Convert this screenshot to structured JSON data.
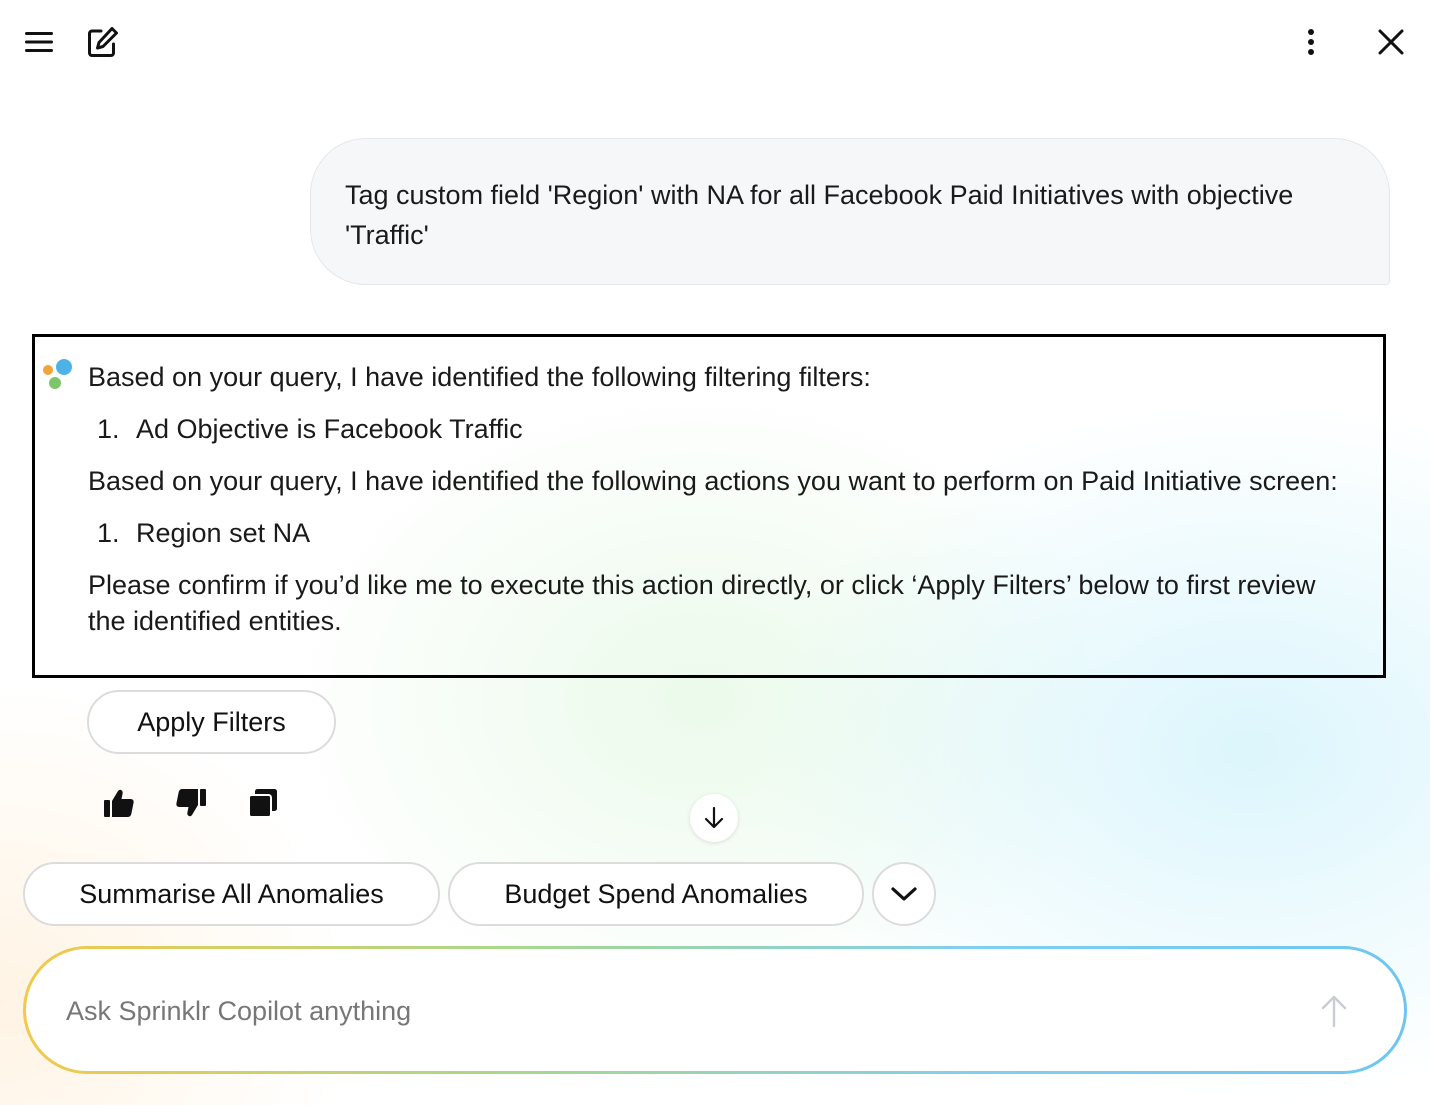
{
  "header": {
    "menu_icon": "hamburger-menu-icon",
    "new_chat_icon": "edit-compose-icon",
    "more_icon": "kebab-more-icon",
    "close_icon": "close-icon"
  },
  "conversation": {
    "user_message": "Tag custom field 'Region' with NA for all Facebook Paid Initiatives with objective 'Traffic'",
    "response": {
      "intro_filters": "Based on your query, I have identified the following filtering filters:",
      "filters": [
        {
          "num": "1.",
          "text": "Ad Objective is Facebook Traffic"
        }
      ],
      "intro_actions": "Based on your query, I have identified the following actions you want to perform on Paid Initiative screen:",
      "actions": [
        {
          "num": "1.",
          "text": "Region set NA"
        }
      ],
      "confirm": "Please confirm if you’d like me to execute this action directly, or click ‘Apply Filters’ below to first review the identified entities."
    },
    "apply_filters_label": "Apply Filters",
    "feedback_icons": [
      "thumbs-up-icon",
      "thumbs-down-icon",
      "copy-icon"
    ]
  },
  "suggestions": {
    "chips": [
      "Summarise All Anomalies",
      "Budget Spend Anomalies"
    ],
    "expand_icon": "chevron-down-icon"
  },
  "composer": {
    "placeholder": "Ask Sprinklr Copilot anything",
    "value": "",
    "send_icon": "arrow-up-icon"
  },
  "colors": {
    "user_bubble_bg": "#f6f7f8",
    "avatar_orange": "#f2a33a",
    "avatar_blue": "#4db3e6",
    "avatar_green": "#7cc56b"
  }
}
